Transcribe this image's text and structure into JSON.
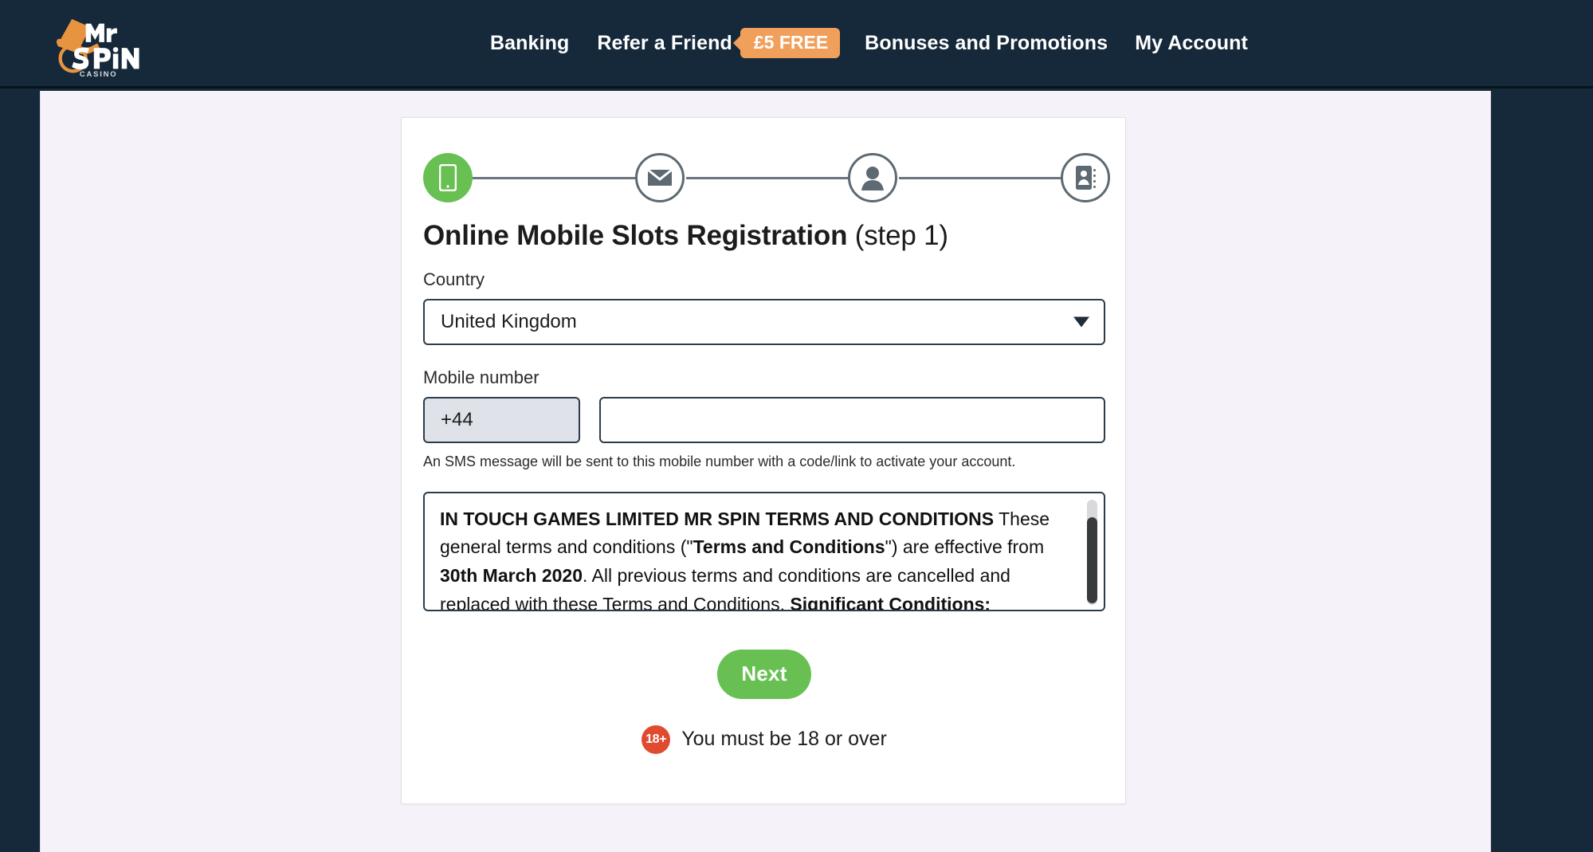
{
  "header": {
    "brand": {
      "name_line1": "Mr",
      "name_line2": "SPiN",
      "name_line3": "CASINO"
    },
    "nav": [
      {
        "label": "Banking",
        "name": "nav-banking"
      },
      {
        "label": "Refer a Friend",
        "name": "nav-refer-a-friend",
        "badge": "£5 FREE"
      },
      {
        "label": "Bonuses and Promotions",
        "name": "nav-bonuses-and-promotions"
      },
      {
        "label": "My Account",
        "name": "nav-my-account"
      }
    ]
  },
  "stepper": {
    "steps": [
      {
        "icon": "mobile-phone-icon",
        "state": "active"
      },
      {
        "icon": "envelope-icon",
        "state": "inactive"
      },
      {
        "icon": "person-icon",
        "state": "inactive"
      },
      {
        "icon": "id-card-icon",
        "state": "inactive"
      }
    ],
    "active_index": 1
  },
  "form": {
    "title_main": "Online Mobile Slots Registration",
    "title_step": " (step 1)",
    "country_label": "Country",
    "country_value": "United Kingdom",
    "country_options": [
      "United Kingdom"
    ],
    "mobile_label": "Mobile number",
    "dial_code": "+44",
    "mobile_value": "",
    "mobile_placeholder": "",
    "sms_note": "An SMS message will be sent to this mobile number with a code/link to activate your account.",
    "terms_html": "<b>IN TOUCH GAMES LIMITED MR SPIN TERMS AND CONDITIONS</b> These general terms and conditions (\"<b>Terms and Conditions</b>\") are effective from <b>30th March 2020</b>. All previous terms and conditions are cancelled and replaced with these Terms and Conditions. <b>Significant Conditions:</b>",
    "next_label": "Next",
    "age_badge": "18+",
    "age_text": "You must be 18 or over"
  },
  "colors": {
    "header_bg": "#15293a",
    "page_bg": "#f5f3f9",
    "card_bg": "#ffffff",
    "accent_orange": "#f0a05a",
    "accent_green": "#68c053",
    "border_dark": "#2b3d4b",
    "age_red": "#e04a2f"
  }
}
